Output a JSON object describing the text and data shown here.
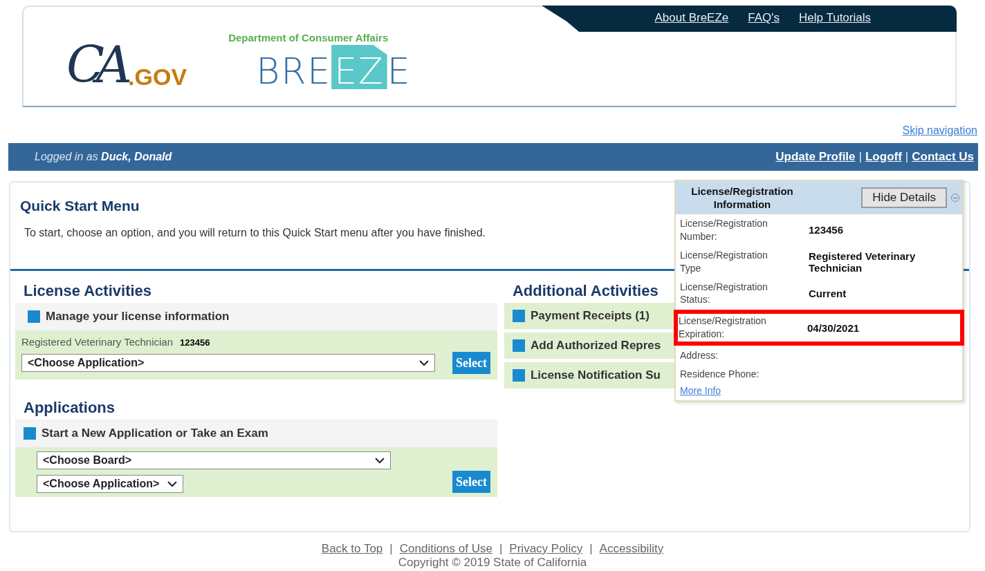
{
  "header": {
    "ca_logo": {
      "script": "CA",
      "suffix": ".GOV"
    },
    "department": "Department of Consumer Affairs",
    "breeze_logo": [
      "BRE",
      "EZ",
      "E"
    ],
    "top_links": [
      "About BreEZe",
      "FAQ's",
      "Help Tutorials"
    ]
  },
  "skip_link": "Skip navigation",
  "user_bar": {
    "prefix": "Logged in as",
    "user": "Duck, Donald",
    "links": [
      {
        "kind": "link",
        "text": "Update Profile"
      },
      {
        "kind": "separator",
        "text": "|"
      },
      {
        "kind": "link",
        "text": "Logoff"
      },
      {
        "kind": "separator",
        "text": "|"
      },
      {
        "kind": "link",
        "text": "Contact Us"
      }
    ]
  },
  "quick_start": {
    "title": "Quick Start Menu",
    "description": "To start, choose an option, and you will return to this Quick Start menu after you have finished."
  },
  "license_activities": {
    "title": "License Activities",
    "section": "Manage your license information",
    "license_type": "Registered Veterinary Technician",
    "license_number": "123456",
    "select": "<Choose Application>",
    "button": "Select"
  },
  "applications": {
    "title": "Applications",
    "section": "Start a New Application or Take an Exam",
    "board_select": "<Choose Board>",
    "application_select": "<Choose Application>",
    "button": "Select"
  },
  "additional_activities": {
    "title": "Additional Activities",
    "items": [
      "Payment Receipts (1)",
      "Add Authorized Repres",
      "License Notification Su"
    ]
  },
  "details_popup": {
    "title": "License/Registration Information",
    "hide_button": "Hide Details",
    "rows": [
      {
        "label": "License/Registration Number:",
        "value": "123456",
        "highlighted": false
      },
      {
        "label": "License/Registration Type",
        "value": "Registered Veterinary Technician",
        "highlighted": false
      },
      {
        "label": "License/Registration Status:",
        "value": "Current",
        "highlighted": false
      },
      {
        "label": "License/Registration Expiration:",
        "value": "04/30/2021",
        "highlighted": true
      },
      {
        "label": "Address:",
        "highlighted": false
      },
      {
        "label": "Residence Phone:",
        "highlighted": false
      }
    ],
    "more_info": "More Info"
  },
  "footer": {
    "links": [
      {
        "kind": "link",
        "text": "Back to Top"
      },
      {
        "kind": "separator",
        "text": "|"
      },
      {
        "kind": "link",
        "text": "Conditions of Use"
      },
      {
        "kind": "separator",
        "text": "|"
      },
      {
        "kind": "link",
        "text": "Privacy Policy"
      },
      {
        "kind": "separator",
        "text": "|"
      },
      {
        "kind": "link",
        "text": "Accessibility"
      }
    ],
    "copyright": "Copyright © 2019 State of California"
  }
}
